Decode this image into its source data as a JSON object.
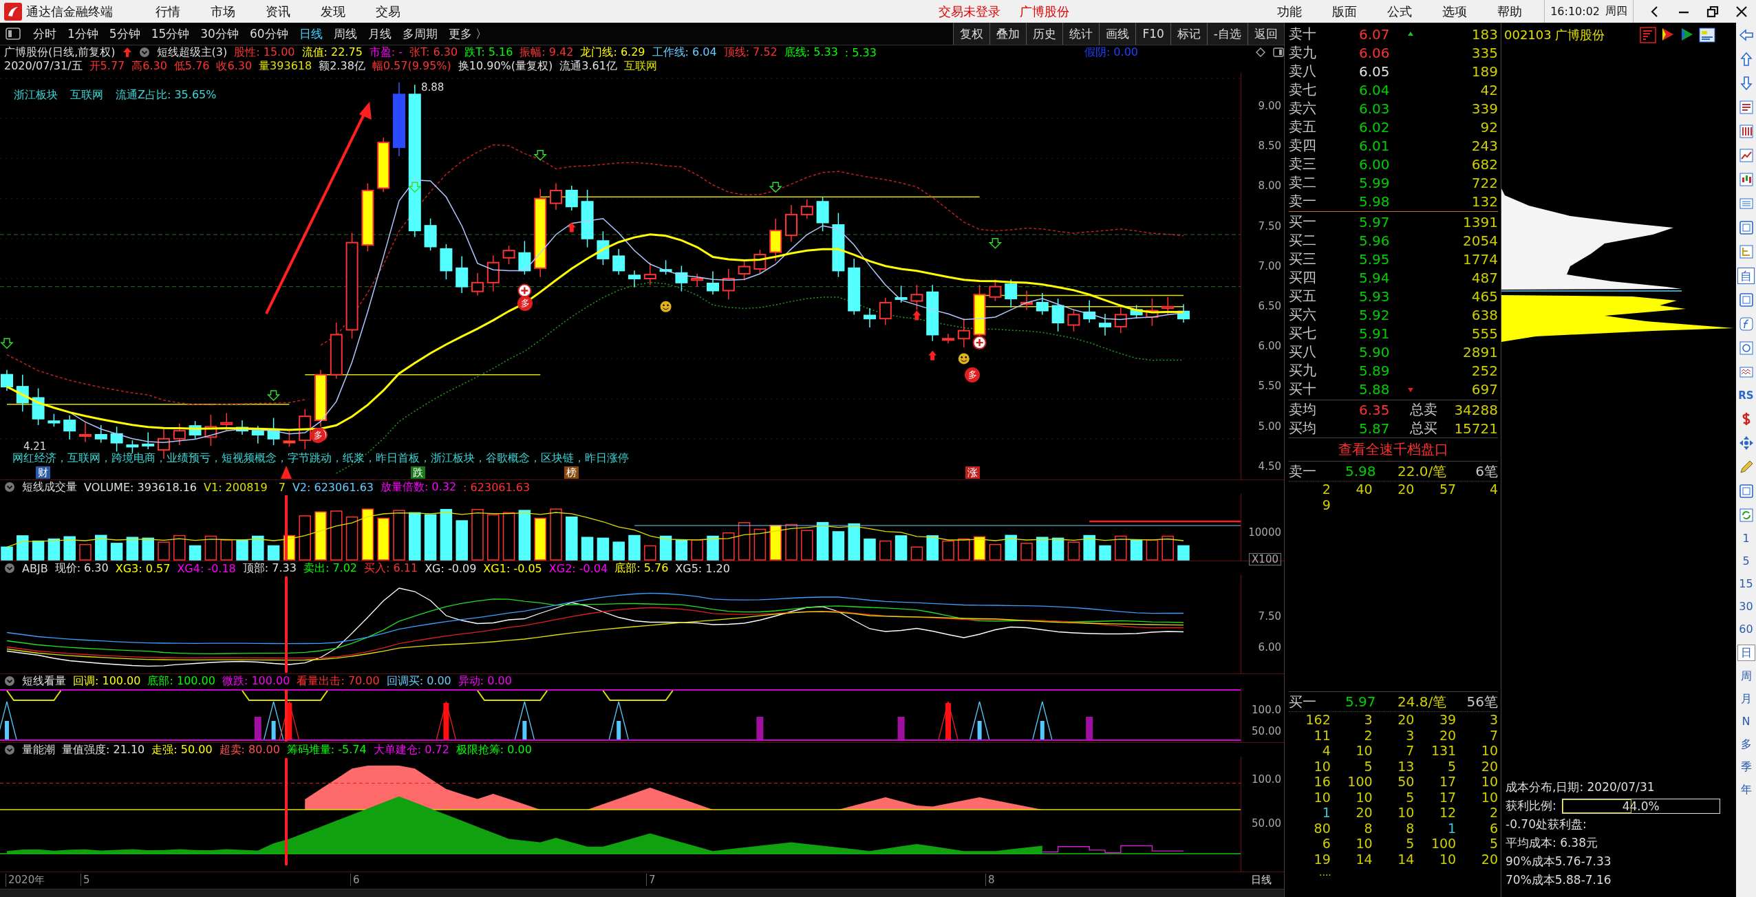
{
  "window": {
    "app_title": "通达信金融终端",
    "menu": [
      "行情",
      "市场",
      "资讯",
      "发现",
      "交易"
    ],
    "login_status": "交易未登录",
    "stock_name": "广博股份",
    "menu_right": [
      "功能",
      "版面",
      "公式",
      "选项",
      "帮助"
    ],
    "clock": "16:10:02",
    "weekday": "周四"
  },
  "period_tabs": [
    {
      "label": "分时",
      "selected": false
    },
    {
      "label": "1分钟",
      "selected": false
    },
    {
      "label": "5分钟",
      "selected": false
    },
    {
      "label": "15分钟",
      "selected": false
    },
    {
      "label": "30分钟",
      "selected": false
    },
    {
      "label": "60分钟",
      "selected": false
    },
    {
      "label": "日线",
      "selected": true
    },
    {
      "label": "周线",
      "selected": false
    },
    {
      "label": "月线",
      "selected": false
    },
    {
      "label": "多周期",
      "selected": false
    },
    {
      "label": "更多 〉",
      "selected": false
    }
  ],
  "chart_buttons": [
    "复权",
    "叠加",
    "历史",
    "统计",
    "画线",
    "F10",
    "标记",
    "-自选",
    "返回"
  ],
  "info_line": {
    "title": "广博股份(日线,前复权)",
    "indicator": "短线超级主(3)",
    "values": [
      {
        "text": "股性: 15.00",
        "color": "#ff3232"
      },
      {
        "text": "流值: 22.75",
        "color": "#ffff00"
      },
      {
        "text": "市盈: -",
        "color": "#ff00ff"
      },
      {
        "text": "张T: 6.30",
        "color": "#ff3232"
      },
      {
        "text": "跌T: 5.16",
        "color": "#00ff00"
      },
      {
        "text": "振幅: 9.42",
        "color": "#ff3232"
      },
      {
        "text": "龙门线: 6.29",
        "color": "#ffff00"
      },
      {
        "text": "工作线: 6.04",
        "color": "#66ccff"
      },
      {
        "text": "顶线: 7.52",
        "color": "#ff3232"
      },
      {
        "text": "底线: 5.33",
        "color": "#00ff00"
      },
      {
        "text": ": 5.33",
        "color": "#00ff00"
      }
    ],
    "extra": {
      "text": "假阴: 0.00",
      "color": "#2040ff"
    }
  },
  "quote_line": [
    {
      "text": "2020/07/31/五",
      "color": "#e0e0e0"
    },
    {
      "text": "开5.77",
      "color": "#ff3232"
    },
    {
      "text": "高6.30",
      "color": "#ff3232"
    },
    {
      "text": "低5.76",
      "color": "#ff3232"
    },
    {
      "text": "收6.30",
      "color": "#ff3232"
    },
    {
      "text": "量393618",
      "color": "#e0e000"
    },
    {
      "text": "额2.38亿",
      "color": "#e0e0e0"
    },
    {
      "text": "幅0.57(9.95%)",
      "color": "#ff3232"
    },
    {
      "text": "换10.90%(量复权)",
      "color": "#e0e0e0"
    },
    {
      "text": "流通3.61亿",
      "color": "#e0e0e0"
    },
    {
      "text": "互联网",
      "color": "#e0e000"
    }
  ],
  "sector_line": [
    "浙江板块",
    "互联网",
    "流通Z占比: 35.65%"
  ],
  "price_labels": [
    "8.88",
    "4.21"
  ],
  "concepts": "网红经济，互联网，跨境电商，业绩预亏，短视频概念，字节跳动，纸浆，昨日首板，浙江板块，谷歌概念，区块链，昨日涨停",
  "events": [
    {
      "label": "财",
      "color": "#2a5aa8"
    },
    {
      "label": "跌",
      "color": "#1a7a1a"
    },
    {
      "label": "榜",
      "color": "#8a4a10"
    },
    {
      "label": "涨",
      "color": "#c02020"
    }
  ],
  "signals": [
    "多",
    "多",
    "多"
  ],
  "price_ticks": [
    "9.00",
    "8.50",
    "8.00",
    "7.50",
    "7.00",
    "6.50",
    "6.00",
    "5.50",
    "5.00",
    "4.50"
  ],
  "indicators": [
    {
      "name": "短线成交量",
      "values": [
        {
          "text": "VOLUME: 393618.16",
          "color": "#e0e0e0"
        },
        {
          "text": "V1: 200819",
          "color": "#e0e000"
        },
        {
          "text": "7",
          "color": "#e0e000"
        },
        {
          "text": "V2: 623061.63",
          "color": "#66ccff"
        },
        {
          "text": "放量倍数: 0.32",
          "color": "#ff00ff"
        },
        {
          "text": ": 623061.63",
          "color": "#ff3232"
        }
      ],
      "ticks": [
        "10000",
        "X100"
      ]
    },
    {
      "name": "ABJB",
      "values": [
        {
          "text": "现价: 6.30",
          "color": "#e0e0e0"
        },
        {
          "text": "XG3: 0.57",
          "color": "#ffff00"
        },
        {
          "text": "XG4: -0.18",
          "color": "#ff00ff"
        },
        {
          "text": "顶部: 7.33",
          "color": "#e0e0e0"
        },
        {
          "text": "卖出: 7.02",
          "color": "#00ff00"
        },
        {
          "text": "买入: 6.11",
          "color": "#ff3232"
        },
        {
          "text": "XG: -0.09",
          "color": "#e0e0e0"
        },
        {
          "text": "XG1: -0.05",
          "color": "#ffff00"
        },
        {
          "text": "XG2: -0.04",
          "color": "#ff00ff"
        },
        {
          "text": "底部: 5.76",
          "color": "#ffff00"
        },
        {
          "text": "XG5: 1.20",
          "color": "#e0e0e0"
        }
      ],
      "ticks": [
        "7.50",
        "6.00"
      ]
    },
    {
      "name": "短线看量",
      "values": [
        {
          "text": "回调: 100.00",
          "color": "#ffff00"
        },
        {
          "text": "底部: 100.00",
          "color": "#00ff00"
        },
        {
          "text": "微跌: 100.00",
          "color": "#ff00ff"
        },
        {
          "text": "看量出击: 70.00",
          "color": "#ff3232"
        },
        {
          "text": "回调买: 0.00",
          "color": "#66ccff"
        },
        {
          "text": "异动: 0.00",
          "color": "#ff00ff"
        }
      ],
      "ticks": [
        "100.0",
        "50.00"
      ]
    },
    {
      "name": "量能潮",
      "values": [
        {
          "text": "量值强度: 21.10",
          "color": "#e0e0e0"
        },
        {
          "text": "走强: 50.00",
          "color": "#ffff00"
        },
        {
          "text": "超卖: 80.00",
          "color": "#ff5050"
        },
        {
          "text": "筹码堆量: -5.74",
          "color": "#00ff00"
        },
        {
          "text": "大单建仓: 0.72",
          "color": "#ff00ff"
        },
        {
          "text": "极限抢筹: 0.00",
          "color": "#00ff00"
        }
      ],
      "ticks": [
        "100.0",
        "50.00"
      ]
    }
  ],
  "x_axis": [
    "2020年",
    "5",
    "6",
    "7",
    "8"
  ],
  "axis_period": "日线",
  "order_book": {
    "asks": [
      {
        "label": "卖十",
        "price": "6.07",
        "volume": "183",
        "color": "#ff3232",
        "kind": "up"
      },
      {
        "label": "卖九",
        "price": "6.06",
        "volume": "335",
        "color": "#ff3232",
        "kind": "plain"
      },
      {
        "label": "卖八",
        "price": "6.05",
        "volume": "189",
        "color": "#e0e0e0",
        "kind": "plain"
      },
      {
        "label": "卖七",
        "price": "6.04",
        "volume": "42",
        "color": "#00d000",
        "kind": "plain"
      },
      {
        "label": "卖六",
        "price": "6.03",
        "volume": "339",
        "color": "#00d000",
        "kind": "plain"
      },
      {
        "label": "卖五",
        "price": "6.02",
        "volume": "92",
        "color": "#00d000",
        "kind": "plain"
      },
      {
        "label": "卖四",
        "price": "6.01",
        "volume": "243",
        "color": "#00d000",
        "kind": "plain"
      },
      {
        "label": "卖三",
        "price": "6.00",
        "volume": "682",
        "color": "#00d000",
        "kind": "plain"
      },
      {
        "label": "卖二",
        "price": "5.99",
        "volume": "722",
        "color": "#00d000",
        "kind": "plain"
      },
      {
        "label": "卖一",
        "price": "5.98",
        "volume": "132",
        "color": "#00d000",
        "kind": "plain"
      }
    ],
    "bids": [
      {
        "label": "买一",
        "price": "5.97",
        "volume": "1391",
        "color": "#00d000",
        "kind": "plain"
      },
      {
        "label": "买二",
        "price": "5.96",
        "volume": "2054",
        "color": "#00d000",
        "kind": "plain"
      },
      {
        "label": "买三",
        "price": "5.95",
        "volume": "1774",
        "color": "#00d000",
        "kind": "plain"
      },
      {
        "label": "买四",
        "price": "5.94",
        "volume": "487",
        "color": "#00d000",
        "kind": "plain"
      },
      {
        "label": "买五",
        "price": "5.93",
        "volume": "465",
        "color": "#00d000",
        "kind": "plain"
      },
      {
        "label": "买六",
        "price": "5.92",
        "volume": "638",
        "color": "#00d000",
        "kind": "plain"
      },
      {
        "label": "买七",
        "price": "5.91",
        "volume": "555",
        "color": "#00d000",
        "kind": "plain"
      },
      {
        "label": "买八",
        "price": "5.90",
        "volume": "2891",
        "color": "#00d000",
        "kind": "plain"
      },
      {
        "label": "买九",
        "price": "5.89",
        "volume": "252",
        "color": "#00d000",
        "kind": "plain"
      },
      {
        "label": "买十",
        "price": "5.88",
        "volume": "697",
        "color": "#00d000",
        "kind": "down"
      }
    ],
    "summary": [
      {
        "label": "卖均",
        "price": "6.35",
        "color": "#ff3232",
        "total_label": "总卖",
        "total": "34288"
      },
      {
        "label": "买均",
        "price": "5.87",
        "color": "#00d000",
        "total_label": "总买",
        "total": "15721"
      }
    ],
    "deep_link": "查看全速千档盘口",
    "sell_queue": {
      "label": "卖一",
      "price": "5.98",
      "avg": "22.0/笔",
      "count": "6笔",
      "orders": [
        {
          "value": "2",
          "small": false
        },
        {
          "value": "40",
          "small": false
        },
        {
          "value": "20",
          "small": false
        },
        {
          "value": "57",
          "small": false
        },
        {
          "value": "4",
          "small": false
        },
        {
          "value": "9",
          "small": false
        }
      ]
    },
    "buy_queue": {
      "label": "买一",
      "price": "5.97",
      "avg": "24.8/笔",
      "count": "56笔",
      "more": "....",
      "orders": [
        {
          "value": "162",
          "small": false
        },
        {
          "value": "3",
          "small": false
        },
        {
          "value": "20",
          "small": false
        },
        {
          "value": "39",
          "small": false
        },
        {
          "value": "3",
          "small": false
        },
        {
          "value": "11",
          "small": false
        },
        {
          "value": "2",
          "small": false
        },
        {
          "value": "3",
          "small": false
        },
        {
          "value": "20",
          "small": false
        },
        {
          "value": "7",
          "small": false
        },
        {
          "value": "4",
          "small": false
        },
        {
          "value": "10",
          "small": false
        },
        {
          "value": "7",
          "small": false
        },
        {
          "value": "131",
          "small": false
        },
        {
          "value": "10",
          "small": false
        },
        {
          "value": "10",
          "small": false
        },
        {
          "value": "5",
          "small": false
        },
        {
          "value": "13",
          "small": false
        },
        {
          "value": "5",
          "small": false
        },
        {
          "value": "20",
          "small": false
        },
        {
          "value": "16",
          "small": false
        },
        {
          "value": "100",
          "small": false
        },
        {
          "value": "50",
          "small": false
        },
        {
          "value": "17",
          "small": false
        },
        {
          "value": "10",
          "small": false
        },
        {
          "value": "10",
          "small": false
        },
        {
          "value": "10",
          "small": false
        },
        {
          "value": "5",
          "small": false
        },
        {
          "value": "17",
          "small": false
        },
        {
          "value": "10",
          "small": false
        },
        {
          "value": "1",
          "small": true
        },
        {
          "value": "20",
          "small": false
        },
        {
          "value": "10",
          "small": false
        },
        {
          "value": "12",
          "small": false
        },
        {
          "value": "2",
          "small": false
        },
        {
          "value": "80",
          "small": false
        },
        {
          "value": "8",
          "small": false
        },
        {
          "value": "8",
          "small": false
        },
        {
          "value": "1",
          "small": true
        },
        {
          "value": "6",
          "small": false
        },
        {
          "value": "6",
          "small": false
        },
        {
          "value": "10",
          "small": false
        },
        {
          "value": "5",
          "small": false
        },
        {
          "value": "100",
          "small": false
        },
        {
          "value": "5",
          "small": false
        },
        {
          "value": "19",
          "small": false
        },
        {
          "value": "14",
          "small": false
        },
        {
          "value": "14",
          "small": false
        },
        {
          "value": "10",
          "small": false
        },
        {
          "value": "20",
          "small": false
        }
      ]
    }
  },
  "chip_panel": {
    "code": "002103 广博股份",
    "date_line": "成本分布,日期: 2020/07/31",
    "profit_label": "获利比例:",
    "profit": {
      "level": 0.44,
      "reading": "44.0%"
    },
    "lines": [
      "-0.70处获利盘:",
      "平均成本: 6.38元",
      "90%成本5.76-7.33",
      "70%成本5.88-7.16"
    ]
  },
  "side_strip": {
    "box_label": "自",
    "rsi_label": "RS",
    "periods": [
      {
        "label": "1",
        "selected": false
      },
      {
        "label": "5",
        "selected": false
      },
      {
        "label": "15",
        "selected": false
      },
      {
        "label": "30",
        "selected": false
      },
      {
        "label": "60",
        "selected": false
      },
      {
        "label": "日",
        "selected": true
      },
      {
        "label": "周",
        "selected": false
      },
      {
        "label": "月",
        "selected": false
      },
      {
        "label": "N",
        "selected": false
      },
      {
        "label": "多",
        "selected": false
      },
      {
        "label": "季",
        "selected": false
      },
      {
        "label": "年",
        "selected": false
      }
    ]
  }
}
